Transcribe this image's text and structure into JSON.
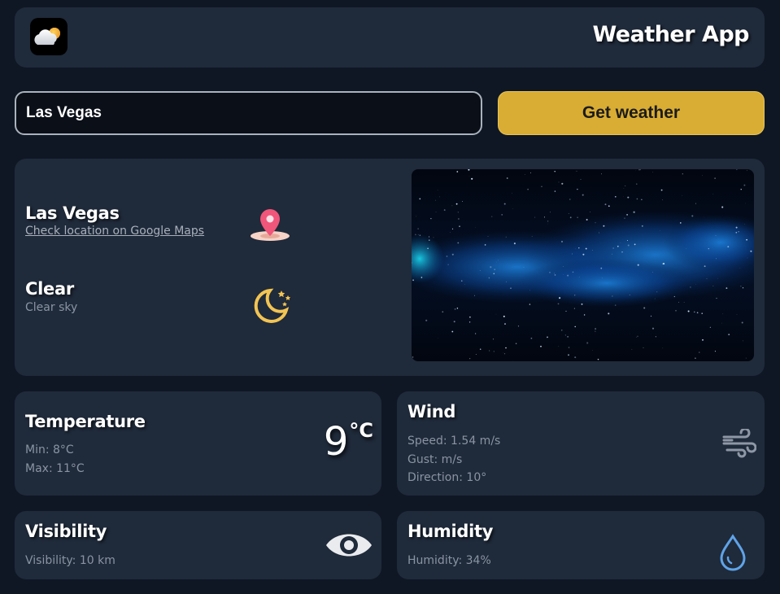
{
  "header": {
    "title": "Weather App",
    "logo_icon": "weather-cloud-sun-icon"
  },
  "search": {
    "value": "Las Vegas",
    "button_label": "Get weather"
  },
  "location": {
    "city": "Las Vegas",
    "maps_link": "Check location on Google Maps",
    "condition": "Clear",
    "description": "Clear sky"
  },
  "temperature": {
    "title": "Temperature",
    "min": "Min: 8°C",
    "max": "Max: 11°C",
    "current": "9",
    "unit": "°C"
  },
  "wind": {
    "title": "Wind",
    "speed": "Speed: 1.54 m/s",
    "gust": "Gust: m/s",
    "direction": "Direction: 10°"
  },
  "visibility": {
    "title": "Visibility",
    "value": "Visibility: 10 km"
  },
  "humidity": {
    "title": "Humidity",
    "value": "Humidity: 34%"
  },
  "colors": {
    "background": "#0f1724",
    "card": "#1f2a3a",
    "accent": "#d9ad33"
  }
}
